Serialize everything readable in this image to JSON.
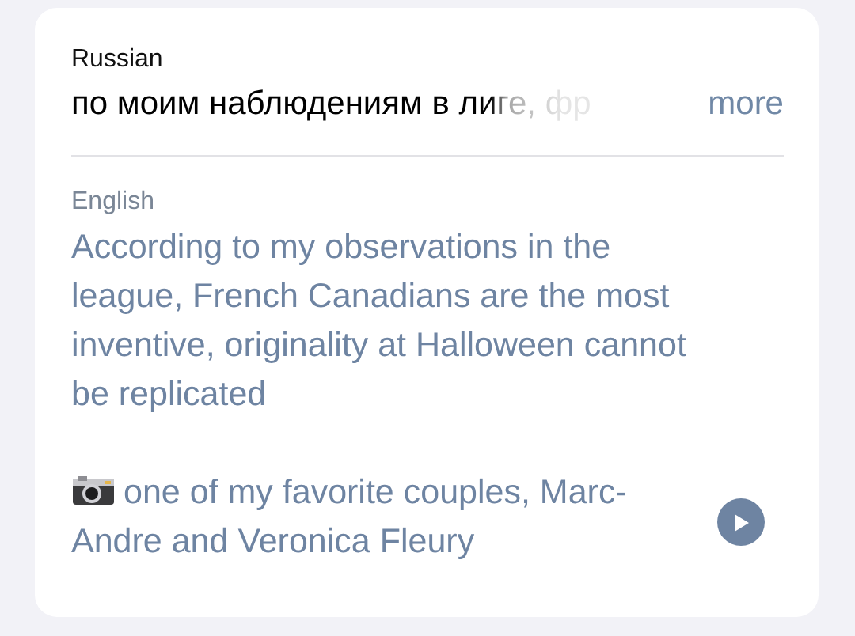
{
  "source": {
    "language": "Russian",
    "text": "по моим наблюдениям в лиге, фр",
    "more": "more"
  },
  "target": {
    "language": "English",
    "paragraphs": [
      {
        "text": "According to my observations in the league, French Canadians are the most inventive, originality at Halloween cannot be replicated"
      },
      {
        "kind": "photo",
        "text": "one of my favorite couples, Marc-Andre and Veronica Fleury"
      }
    ]
  }
}
